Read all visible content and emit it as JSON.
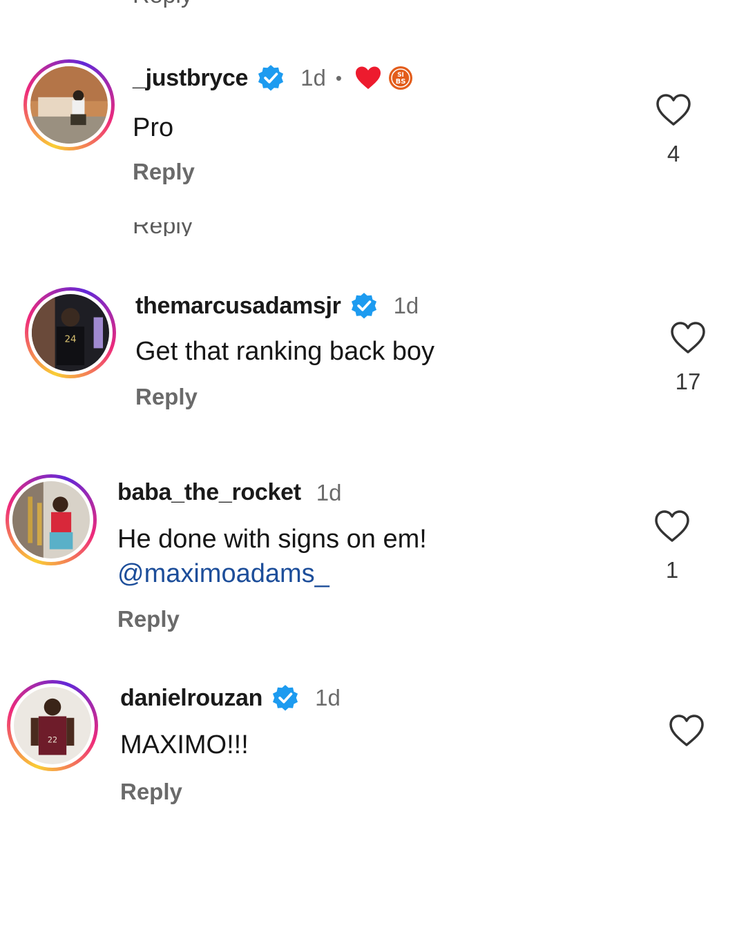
{
  "reply_label": "Reply",
  "colors": {
    "verified": "#1d9bf0",
    "mention": "#1d4e9a",
    "heart_red": "#ed1b2e",
    "badge_orange": "#e35d1b"
  },
  "comments": [
    {
      "username": "_justbryce",
      "verified": true,
      "time": "1d",
      "separator": "•",
      "reactions": [
        "heart-icon",
        "sticker-badge-icon"
      ],
      "badge_text": "SI\nBS",
      "text": "Pro",
      "mention": "",
      "likes": "4"
    },
    {
      "username": "themarcusadamsjr",
      "verified": true,
      "time": "1d",
      "text": "Get that ranking back boy",
      "mention": "",
      "likes": "17"
    },
    {
      "username": "baba_the_rocket",
      "verified": false,
      "time": "1d",
      "text": "He done with signs on em!",
      "mention": "@maximoadams_",
      "likes": "1"
    },
    {
      "username": "danielrouzan",
      "verified": true,
      "time": "1d",
      "text": "MAXIMO!!!",
      "mention": "",
      "likes": ""
    }
  ]
}
